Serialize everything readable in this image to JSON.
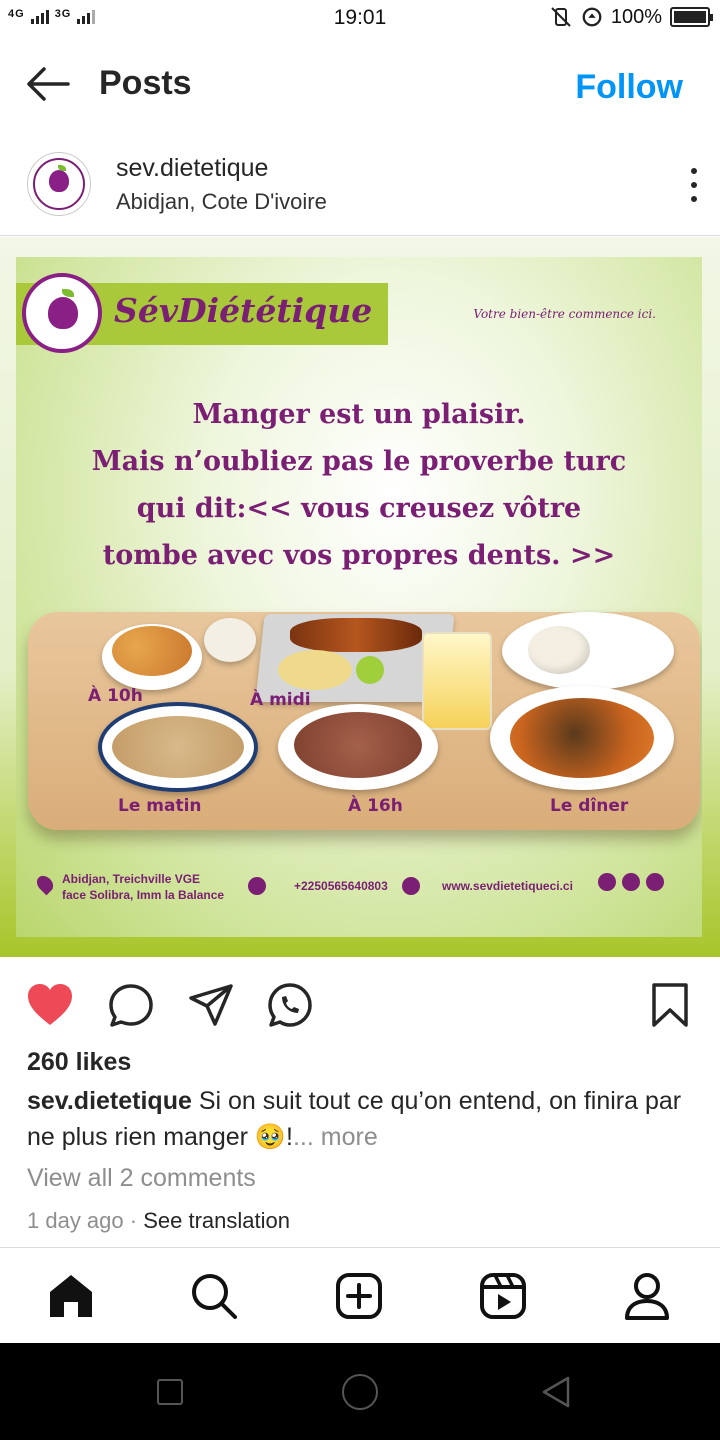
{
  "status_bar": {
    "network_left": "4G",
    "network_right": "3G",
    "time": "19:01",
    "battery": "100%"
  },
  "header": {
    "title": "Posts",
    "follow_label": "Follow"
  },
  "author": {
    "username": "sev.dietetique",
    "location": "Abidjan, Cote D'ivoire"
  },
  "post_image": {
    "brand_name": "SévDiététique",
    "tagline": "Votre bien-être commence ici.",
    "quote_lines": [
      "Manger est un plaisir.",
      "Mais n’oubliez pas le proverbe turc",
      "qui dit:<< vous creusez vôtre",
      "tombe avec vos propres dents. >>"
    ],
    "labels": {
      "a10h": "À 10h",
      "midi": "À midi",
      "matin": "Le matin",
      "a16h": "À 16h",
      "diner": "Le dîner"
    },
    "address_line1": "Abidjan, Treichville VGE",
    "address_line2": "face Solibra, Imm la Balance",
    "phone": "+2250565640803",
    "website": "www.sevdietetiqueci.ci"
  },
  "post": {
    "likes": "260 likes",
    "caption_user": "sev.dietetique",
    "caption_text": " Si on suit tout ce qu’on entend, on finira par ne plus rien manger 🥹!",
    "more_label": "... more",
    "view_comments": "View all 2 comments",
    "time_ago": "1 day ago",
    "separator": " · ",
    "see_translation": "See translation"
  },
  "colors": {
    "like_red": "#ed4956",
    "follow_blue": "#0095f6",
    "brand_purple": "#7a1f73",
    "brand_green": "#a9c93a"
  },
  "icons": [
    "back-arrow-icon",
    "more-vertical-icon",
    "heart-icon",
    "comment-icon",
    "share-icon",
    "whatsapp-icon",
    "bookmark-icon",
    "home-icon",
    "search-icon",
    "create-icon",
    "reels-icon",
    "profile-icon"
  ]
}
